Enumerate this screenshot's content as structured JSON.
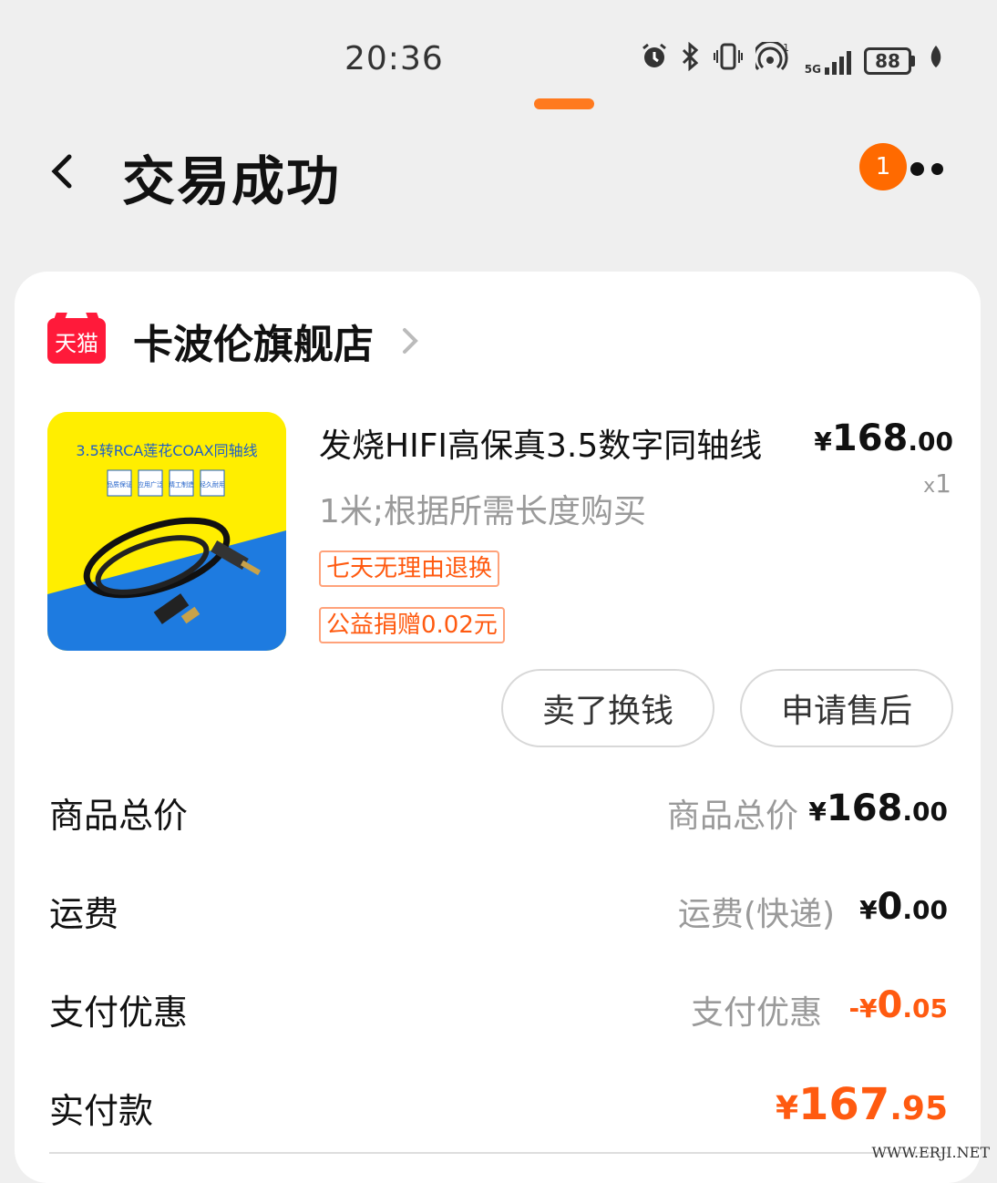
{
  "status_bar": {
    "time": "20:36",
    "icons": [
      "alarm-icon",
      "bluetooth-icon",
      "vibrate-icon",
      "hotspot-icon",
      "signal-icon",
      "battery-icon",
      "leaf-icon"
    ],
    "hotspot_count": "1",
    "network_type": "5G",
    "battery_level": "88"
  },
  "nav": {
    "title": "交易成功",
    "back_icon": "chevron-left-icon",
    "more_icon": "more-icon",
    "notification_count": "1"
  },
  "shop": {
    "platform_logo": "天猫",
    "name": "卡波伦旗舰店"
  },
  "product": {
    "title": "发烧HIFI高保真3.5数字同轴线",
    "spec": "1米;根据所需长度购买",
    "price_symbol": "¥",
    "price_int": "168",
    "price_dec": ".00",
    "qty_prefix": "x",
    "qty": "1",
    "tags": [
      "七天无理由退换",
      "公益捐赠0.02元"
    ],
    "image_text": {
      "headline": "3.5转RCA莲花COAX同轴线",
      "badges": [
        "品质保证",
        "应用广泛",
        "精工制造",
        "经久耐用"
      ]
    }
  },
  "actions": {
    "sell": "卖了换钱",
    "after_sales": "申请售后"
  },
  "summary": {
    "rows": [
      {
        "label": "商品总价",
        "sub": "商品总价",
        "symbol": "¥",
        "int": "168",
        "dec": ".00"
      },
      {
        "label": "运费",
        "sub": "运费(快递)",
        "symbol": "¥",
        "int": "0",
        "dec": ".00"
      },
      {
        "label": "支付优惠",
        "sub": "支付优惠",
        "symbol": "-¥",
        "int": "0",
        "dec": ".05"
      },
      {
        "label": "实付款",
        "symbol": "¥",
        "int": "167",
        "dec": ".95"
      }
    ]
  },
  "colors": {
    "accent": "#ff5a10",
    "tmall_red": "#ff1a3a",
    "badge": "#ff6a00",
    "background": "#efefef"
  },
  "watermark": "WWW.ERJI.NET"
}
